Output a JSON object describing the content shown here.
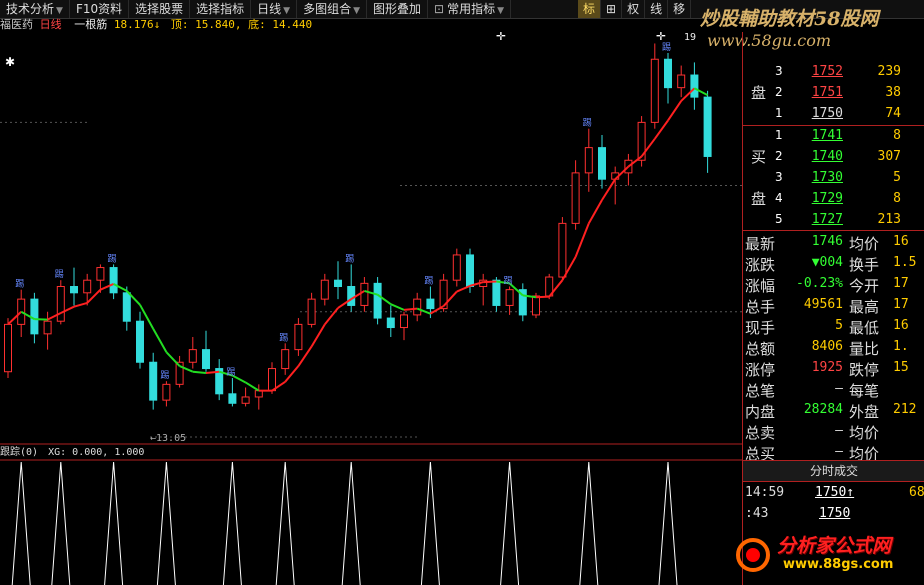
{
  "toolbar": {
    "items": [
      "技术分析",
      "F10资料",
      "选择股票",
      "选择指标",
      "日线",
      "多图组合",
      "图形叠加",
      "常用指标"
    ],
    "right": [
      "标",
      "⊞",
      "权",
      "线",
      "移"
    ]
  },
  "info": {
    "stock_name": "福医药",
    "period": "日线",
    "indicator": "一根筋",
    "indicator_value": "18.176↓",
    "top_label": "顶:",
    "top_value": "15.840,",
    "bottom_label": "底:",
    "bottom_value": "14.440"
  },
  "watermark": {
    "line1": "炒股輔助教材58股网",
    "line2": "www.58gu.com"
  },
  "chart_labels": {
    "low_marker": "←13.05",
    "high_marker": "19",
    "pattern_tag": "踢"
  },
  "indicator_panel": {
    "title": "跟踪(0)",
    "formula": "XG: 0.000, 1.000"
  },
  "orderbook": {
    "sell_tag": "盘",
    "buy_tag_1": "买",
    "buy_tag_2": "盘",
    "sell": [
      {
        "level": "3",
        "price": "1752",
        "vol": "239"
      },
      {
        "level": "2",
        "price": "1751",
        "vol": "38"
      },
      {
        "level": "1",
        "price": "1750",
        "vol": "74"
      }
    ],
    "buy": [
      {
        "level": "1",
        "price": "1741",
        "vol": "8"
      },
      {
        "level": "2",
        "price": "1740",
        "vol": "307"
      },
      {
        "level": "3",
        "price": "1730",
        "vol": "5"
      },
      {
        "level": "4",
        "price": "1729",
        "vol": "8"
      },
      {
        "level": "5",
        "price": "1727",
        "vol": "213"
      }
    ]
  },
  "quote": [
    {
      "l": "最新",
      "v": "1746",
      "vc": "#33ff33",
      "r": "均价",
      "rv": "16"
    },
    {
      "l": "涨跌",
      "v": "▼004",
      "vc": "#33ff33",
      "r": "换手",
      "rv": "1.5"
    },
    {
      "l": "涨幅",
      "v": "-0.23%",
      "vc": "#33ff33",
      "r": "今开",
      "rv": "17"
    },
    {
      "l": "总手",
      "v": "49561",
      "vc": "#ffcc00",
      "r": "最高",
      "rv": "17"
    },
    {
      "l": "现手",
      "v": "5",
      "vc": "#ffcc00",
      "r": "最低",
      "rv": "16"
    },
    {
      "l": "总额",
      "v": "8406",
      "vc": "#ffcc00",
      "r": "量比",
      "rv": "1."
    },
    {
      "l": "涨停",
      "v": "1925",
      "vc": "#ff4444",
      "r": "跌停",
      "rv": "15"
    },
    {
      "l": "总笔",
      "v": "–",
      "vc": "#dddddd",
      "r": "每笔",
      "rv": ""
    },
    {
      "l": "内盘",
      "v": "28284",
      "vc": "#33ff33",
      "r": "外盘",
      "rv": "212"
    },
    {
      "l": "总卖",
      "v": "–",
      "vc": "#dddddd",
      "r": "均价",
      "rv": ""
    },
    {
      "l": "总买",
      "v": "–",
      "vc": "#dddddd",
      "r": "均价",
      "rv": ""
    }
  ],
  "timesales": {
    "header": "分时成交",
    "rows": [
      {
        "time": "14:59",
        "price": "1750↑",
        "vol": "68"
      },
      {
        "time": ":43",
        "price": "1750",
        "vol": ""
      }
    ]
  },
  "logo": {
    "text": "分析家公式网",
    "url": "www.88gs.com"
  },
  "chart_data": {
    "type": "candlestick",
    "ylim": [
      13.0,
      19.4
    ],
    "candles": [
      [
        14.05,
        14.9,
        13.95,
        14.8
      ],
      [
        14.8,
        15.35,
        14.6,
        15.2
      ],
      [
        15.2,
        15.3,
        14.5,
        14.65
      ],
      [
        14.65,
        15.0,
        14.4,
        14.85
      ],
      [
        14.85,
        15.5,
        14.8,
        15.4
      ],
      [
        15.4,
        15.7,
        15.1,
        15.3
      ],
      [
        15.3,
        15.6,
        15.1,
        15.5
      ],
      [
        15.5,
        15.75,
        15.3,
        15.7
      ],
      [
        15.7,
        15.75,
        15.2,
        15.3
      ],
      [
        15.3,
        15.4,
        14.7,
        14.85
      ],
      [
        14.85,
        15.0,
        14.1,
        14.2
      ],
      [
        14.2,
        14.35,
        13.45,
        13.6
      ],
      [
        13.6,
        13.9,
        13.5,
        13.85
      ],
      [
        13.85,
        14.3,
        13.8,
        14.2
      ],
      [
        14.2,
        14.6,
        14.1,
        14.4
      ],
      [
        14.4,
        14.7,
        14.05,
        14.1
      ],
      [
        14.1,
        14.25,
        13.6,
        13.7
      ],
      [
        13.7,
        13.95,
        13.5,
        13.55
      ],
      [
        13.55,
        13.8,
        13.5,
        13.65
      ],
      [
        13.65,
        13.85,
        13.45,
        13.75
      ],
      [
        13.75,
        14.2,
        13.7,
        14.1
      ],
      [
        14.1,
        14.5,
        14.0,
        14.4
      ],
      [
        14.4,
        14.9,
        14.3,
        14.8
      ],
      [
        14.8,
        15.3,
        14.75,
        15.2
      ],
      [
        15.2,
        15.6,
        15.1,
        15.5
      ],
      [
        15.5,
        15.8,
        15.2,
        15.4
      ],
      [
        15.4,
        15.75,
        15.0,
        15.1
      ],
      [
        15.1,
        15.55,
        15.0,
        15.45
      ],
      [
        15.45,
        15.55,
        14.8,
        14.9
      ],
      [
        14.9,
        15.1,
        14.6,
        14.75
      ],
      [
        14.75,
        15.0,
        14.55,
        14.95
      ],
      [
        14.95,
        15.3,
        14.85,
        15.2
      ],
      [
        15.2,
        15.4,
        14.9,
        15.05
      ],
      [
        15.05,
        15.6,
        15.0,
        15.5
      ],
      [
        15.5,
        16.0,
        15.4,
        15.9
      ],
      [
        15.9,
        16.0,
        15.3,
        15.4
      ],
      [
        15.4,
        15.6,
        15.1,
        15.5
      ],
      [
        15.5,
        15.55,
        15.0,
        15.1
      ],
      [
        15.1,
        15.4,
        14.95,
        15.35
      ],
      [
        15.35,
        15.45,
        14.85,
        14.95
      ],
      [
        14.95,
        15.3,
        14.9,
        15.25
      ],
      [
        15.25,
        15.6,
        15.2,
        15.55
      ],
      [
        15.55,
        16.5,
        15.5,
        16.4
      ],
      [
        16.4,
        17.4,
        16.3,
        17.2
      ],
      [
        17.2,
        17.9,
        16.9,
        17.6
      ],
      [
        17.6,
        17.8,
        16.95,
        17.1
      ],
      [
        17.1,
        17.3,
        16.7,
        17.2
      ],
      [
        17.2,
        17.5,
        17.0,
        17.4
      ],
      [
        17.4,
        18.1,
        17.3,
        18.0
      ],
      [
        18.0,
        19.25,
        17.9,
        19.0
      ],
      [
        19.0,
        19.1,
        18.3,
        18.55
      ],
      [
        18.55,
        18.9,
        18.4,
        18.75
      ],
      [
        18.75,
        18.95,
        18.2,
        18.4
      ],
      [
        18.4,
        18.5,
        17.2,
        17.46
      ]
    ],
    "xg_signal_positions": [
      1,
      4,
      8,
      12,
      17,
      21,
      26,
      32,
      38,
      44,
      50
    ]
  }
}
